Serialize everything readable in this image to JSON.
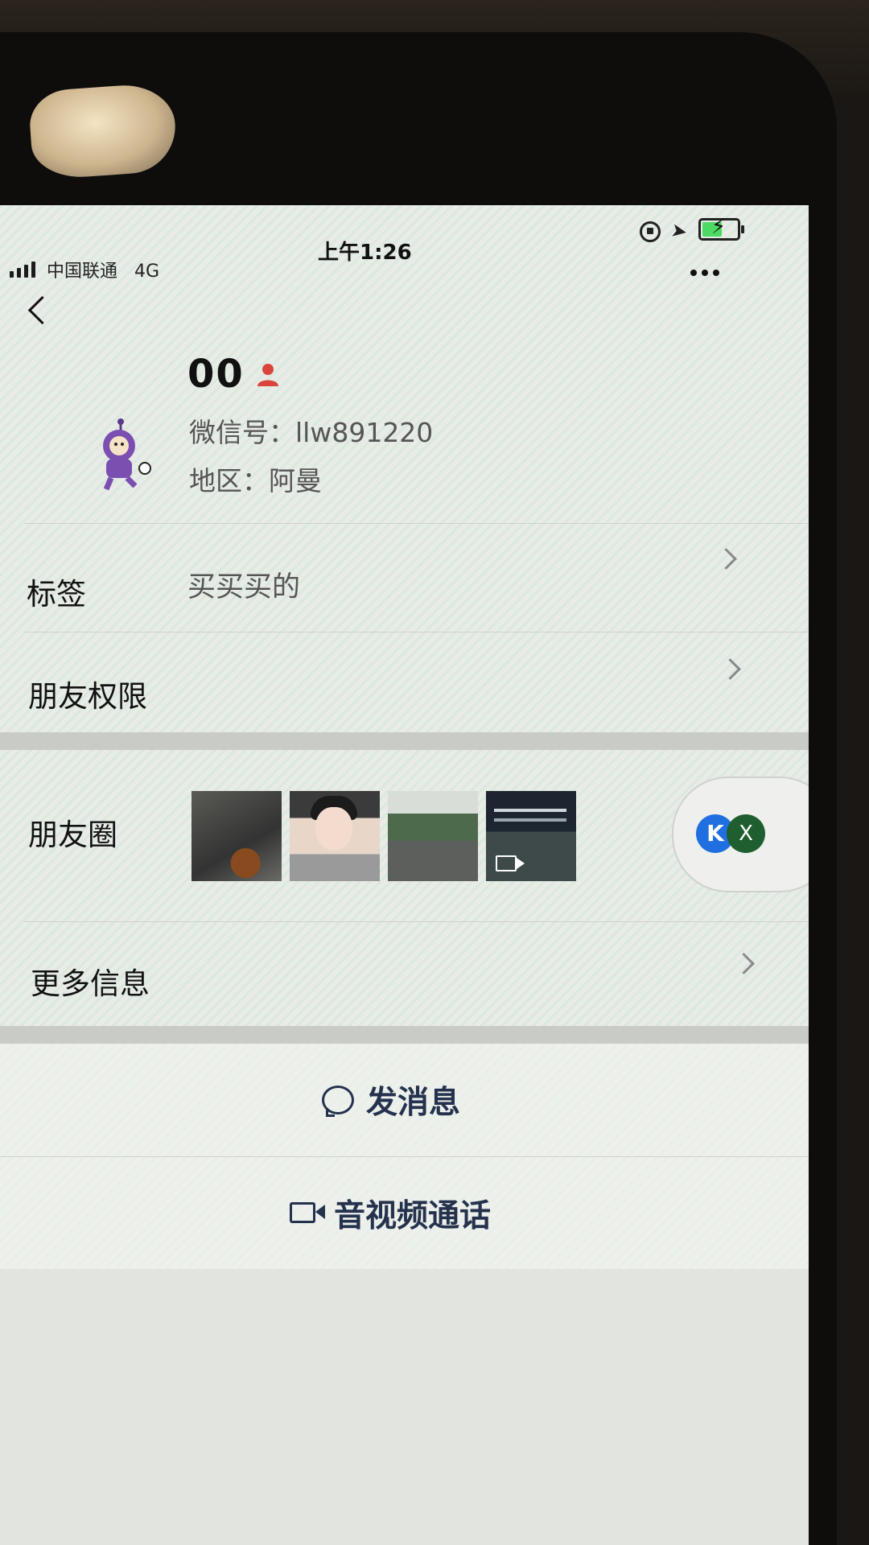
{
  "status_bar": {
    "carrier": "中国联通",
    "network": "4G",
    "time": "上午1:26"
  },
  "profile": {
    "name": "00",
    "wechat_id": "微信号：llw891220",
    "region": "地区：阿曼"
  },
  "rows": {
    "tags_label": "标签",
    "tags_value": "买买买的",
    "permissions_label": "朋友权限",
    "moments_label": "朋友圈",
    "more_info_label": "更多信息"
  },
  "floating_pill": {
    "left_badge": "K",
    "right_badge": "X"
  },
  "actions": {
    "message_label": "发消息",
    "call_label": "音视频通话"
  },
  "colors": {
    "action_text": "#25324d",
    "battery": "#4cd964",
    "badge_red": "#d9453b"
  },
  "icons": [
    "back-chevron-icon",
    "more-dots-icon",
    "chat-bubble-icon",
    "video-camera-icon",
    "chevron-right-icon"
  ]
}
